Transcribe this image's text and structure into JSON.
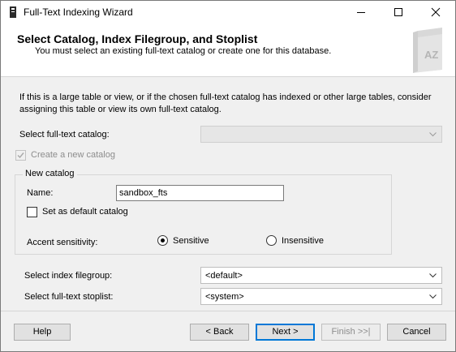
{
  "window": {
    "title": "Full-Text Indexing Wizard"
  },
  "header": {
    "title": "Select Catalog, Index Filegroup, and Stoplist",
    "subtitle": "You must select an existing full-text catalog or create one for this database.",
    "art_text": "AZ"
  },
  "intro": "If this is a large table or view, or if the chosen full-text catalog has indexed or other large tables, consider assigning this table or view its own full-text catalog.",
  "catalog": {
    "label": "Select full-text catalog:",
    "value": ""
  },
  "create_new": {
    "label": "Create a new catalog",
    "checked": true,
    "enabled": false
  },
  "new_catalog": {
    "group_title": "New catalog",
    "name_label": "Name:",
    "name_value": "sandbox_fts",
    "default_label": "Set as default catalog",
    "accent_label": "Accent sensitivity:",
    "sensitive_label": "Sensitive",
    "insensitive_label": "Insensitive",
    "accent_selected": "Sensitive"
  },
  "filegroup": {
    "label": "Select index filegroup:",
    "value": "<default>"
  },
  "stoplist": {
    "label": "Select full-text stoplist:",
    "value": "<system>"
  },
  "buttons": {
    "help": "Help",
    "back": "< Back",
    "next": "Next >",
    "finish": "Finish >>|",
    "cancel": "Cancel"
  }
}
